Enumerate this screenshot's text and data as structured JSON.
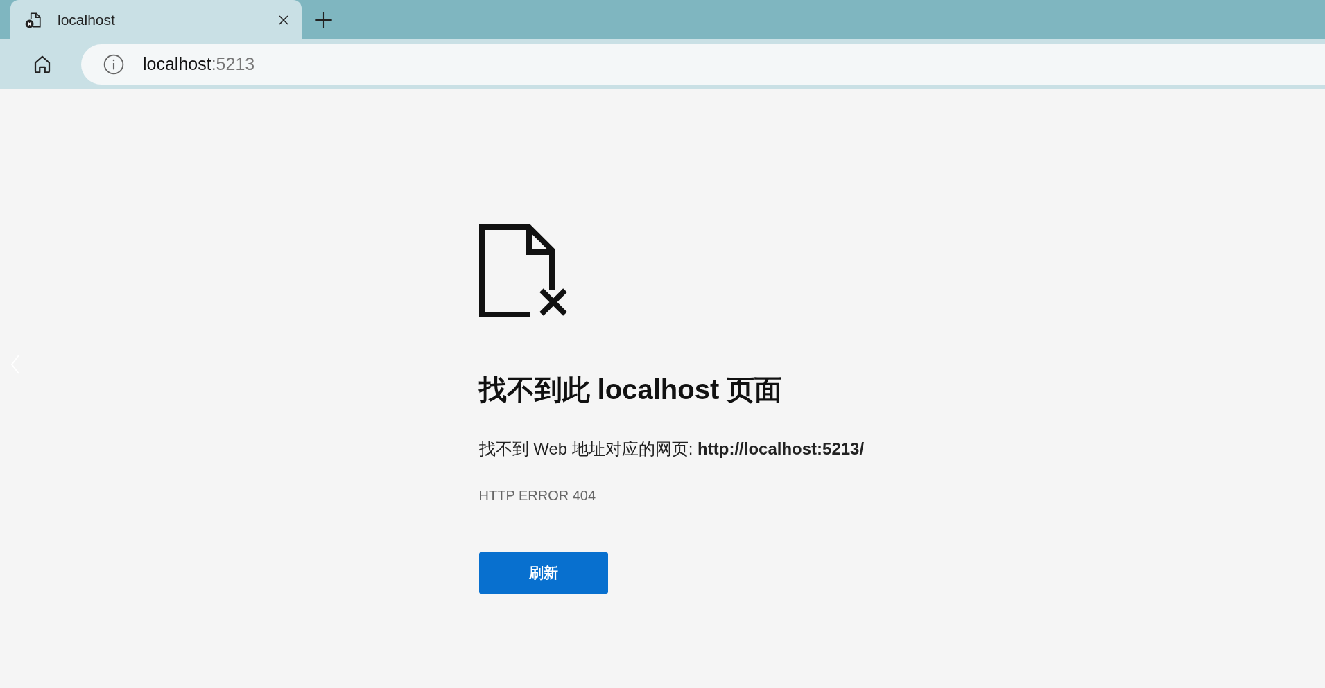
{
  "tabs": [
    {
      "title": "localhost",
      "selected": true
    }
  ],
  "address_bar": {
    "host": "localhost",
    "port": ":5213"
  },
  "error_page": {
    "heading": "找不到此 localhost 页面",
    "message": "找不到 Web 地址对应的网页: **http://localhost:5213/**",
    "error_code": "HTTP ERROR 404",
    "button": "刷新"
  }
}
